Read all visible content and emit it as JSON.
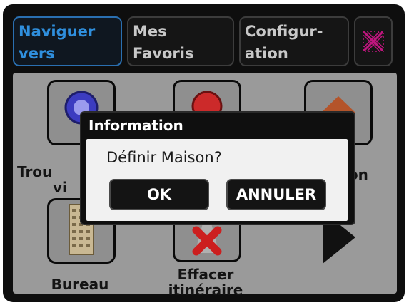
{
  "tabs": [
    {
      "label": "Naviguer\nvers",
      "active": true
    },
    {
      "label": "Mes\nFavoris",
      "active": false
    },
    {
      "label": "Configur-\nation",
      "active": false
    }
  ],
  "close_icon": "close-x-icon",
  "colors": {
    "active_tab_text": "#2f8fdd",
    "inactive_tab_text": "#c8c8c8",
    "close_icon": "#c0157e",
    "panel_background": "#9a9a9a",
    "delete_icon": "#cc1f1f"
  },
  "menu": {
    "items": [
      {
        "label_line1": "Trou",
        "label_line2": "vi",
        "icon": "search-globe-icon"
      },
      {
        "label_line1": "",
        "label_line2": "",
        "icon": "location-icon"
      },
      {
        "label_line1": "son",
        "label_line2": "",
        "icon": "house-icon"
      },
      {
        "label_line1": "Bureau",
        "label_line2": "",
        "icon": "office-building-icon"
      },
      {
        "label_line1": "Effacer",
        "label_line2": "itinéraire",
        "icon": "delete-route-icon"
      }
    ],
    "next_icon": "arrow-right-icon"
  },
  "dialog": {
    "title": "Information",
    "message": "Définir Maison?",
    "ok_label": "OK",
    "cancel_label": "ANNULER"
  }
}
